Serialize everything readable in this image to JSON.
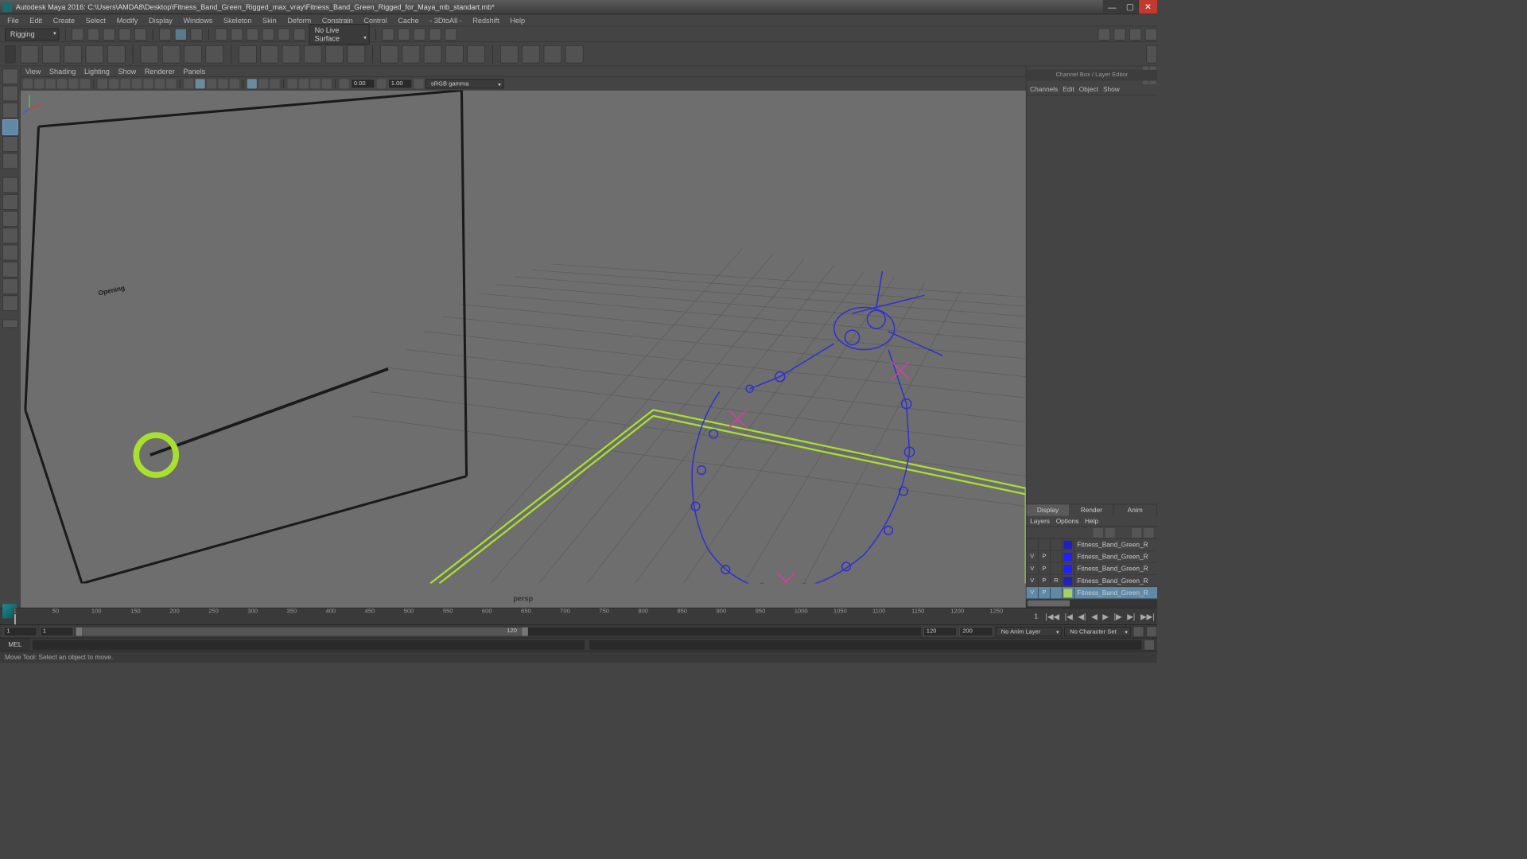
{
  "title": "Autodesk Maya 2016: C:\\Users\\AMDA8\\Desktop\\Fitness_Band_Green_Rigged_max_vray\\Fitness_Band_Green_Rigged_for_Maya_mb_standart.mb*",
  "menubar": [
    "File",
    "Edit",
    "Create",
    "Select",
    "Modify",
    "Display",
    "Windows",
    "Skeleton",
    "Skin",
    "Deform",
    "Constrain",
    "Control",
    "Cache",
    "- 3DtoAll -",
    "Redshift",
    "Help"
  ],
  "workspace_dropdown": "Rigging",
  "live_surface": "No Live Surface",
  "viewport_menus": [
    "View",
    "Shading",
    "Lighting",
    "Show",
    "Renderer",
    "Panels"
  ],
  "vp_field1": "0.00",
  "vp_field2": "1.00",
  "colorspace_dropdown": "sRGB gamma",
  "camera_label": "persp",
  "channelbox": {
    "title": "Channel Box / Layer Editor",
    "tabs": [
      "Channels",
      "Edit",
      "Object",
      "Show"
    ],
    "display_tabs": [
      "Display",
      "Render",
      "Anim"
    ],
    "layer_menus": [
      "Layers",
      "Options",
      "Help"
    ],
    "layers": [
      {
        "v": "",
        "p": "",
        "r": "",
        "color": "#2020c0",
        "name": "Fitness_Band_Green_R",
        "sel": false
      },
      {
        "v": "V",
        "p": "P",
        "r": "",
        "color": "#2020ff",
        "name": "Fitness_Band_Green_R",
        "sel": false
      },
      {
        "v": "V",
        "p": "P",
        "r": "",
        "color": "#2020ff",
        "name": "Fitness_Band_Green_R",
        "sel": false
      },
      {
        "v": "V",
        "p": "P",
        "r": "R",
        "color": "#2020c0",
        "name": "Fitness_Band_Green_R",
        "sel": false
      },
      {
        "v": "V",
        "p": "P",
        "r": "",
        "color": "#a8d060",
        "name": "Fitness_Band_Green_R",
        "sel": true
      }
    ]
  },
  "timeline": {
    "current": "1",
    "ticks": [
      "1",
      "50",
      "100",
      "150",
      "200",
      "250",
      "300",
      "350",
      "400",
      "450",
      "500",
      "550",
      "600",
      "650",
      "700",
      "750",
      "800",
      "850",
      "900",
      "950",
      "1000",
      "1050",
      "1100",
      "1150",
      "1200",
      "1250"
    ],
    "end": "1"
  },
  "range": {
    "start": "1",
    "inStart": "1",
    "outEnd": "120",
    "end": "200",
    "inVal": "120"
  },
  "anim_layer": "No Anim Layer",
  "char_set": "No Character Set",
  "mel_label": "MEL",
  "status": "Move Tool: Select an object to move.",
  "opening_text": "Opening"
}
